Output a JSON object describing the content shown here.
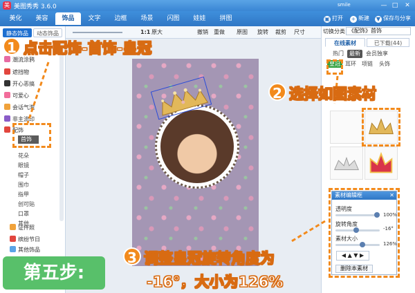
{
  "app": {
    "title": "美图秀秀 3.6.0",
    "user": "smile",
    "logo_text": "美"
  },
  "window_buttons": [
    "—",
    "□",
    "✕"
  ],
  "main_tabs": [
    {
      "label": "美化"
    },
    {
      "label": "美容"
    },
    {
      "label": "饰品"
    },
    {
      "label": "文字"
    },
    {
      "label": "边框"
    },
    {
      "label": "场景"
    },
    {
      "label": "闪图"
    },
    {
      "label": "娃娃"
    },
    {
      "label": "拼图"
    }
  ],
  "right_tools": {
    "open": "打开",
    "new": "新建",
    "save": "保存与分享"
  },
  "edit_toolbar": {
    "zoom_ratio": "1:1",
    "original_size": "原大",
    "undo": "撤销",
    "redo": "重做",
    "original": "原图",
    "rotate": "旋转",
    "crop": "裁剪",
    "resize": "尺寸"
  },
  "left_panel": {
    "tabs": [
      "静态饰品",
      "动态饰品"
    ],
    "items": [
      "潮流涂鸦",
      "遮挡物",
      "开心恶搞",
      "可爱心",
      "会话气泡",
      "非主流印",
      "配饰"
    ],
    "subitems": [
      "首饰",
      "花朵",
      "眼镜",
      "帽子",
      "围巾",
      "指甲",
      "创可贴",
      "口罩",
      "其他"
    ],
    "bottom_items": [
      "证件照",
      "缤纷节日",
      "其他饰品"
    ]
  },
  "right_panel": {
    "category_label": "切换分类",
    "category_value": "《配饰》首饰",
    "tabs": [
      "在线素材",
      "已下载(44)"
    ],
    "categories": [
      "热门",
      "最新",
      "会员独享"
    ],
    "subcategories": [
      "皇冠",
      "耳环",
      "项链",
      "头饰"
    ]
  },
  "dialog": {
    "title": "素材编辑框",
    "close": "✕",
    "transparency_label": "透明度",
    "transparency_value": "100%",
    "transparency": 1.0,
    "rotation_label": "旋转角度",
    "rotation_value": "-16°",
    "rotation": -16,
    "size_label": "素材大小",
    "size_value": "126%",
    "size": 1.26,
    "delete_label": "删除本素材"
  },
  "annotations": {
    "step1_number": "1",
    "step1_text": "点击配饰-首饰-皇冠",
    "step2_number": "2",
    "step2_text": "选择如图素材",
    "step3_number": "3",
    "step3_line1": "调整皇冠旋转角度为",
    "step3_line2": "-16°，大小为126%",
    "step_badge": "第五步:"
  },
  "colors": {
    "accent": "#2f77c6",
    "annotation_orange": "#f28a1c",
    "badge_green": "#58c06a",
    "selected_sub": "#2f9f3c"
  }
}
